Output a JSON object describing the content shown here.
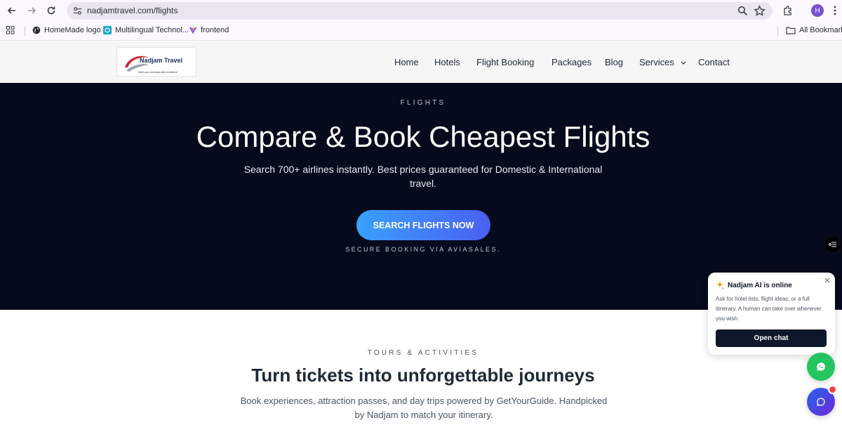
{
  "browser": {
    "url": "nadjamtravel.com/flights",
    "profile_initial": "H",
    "bookmarks": [
      "HomeMade logo",
      "Multilingual Technol...",
      "frontend"
    ],
    "all_bookmarks": "All Bookmarks"
  },
  "header": {
    "logo_text": "Nadjam Travel",
    "logo_tagline": "Meet your necessity with excellence",
    "nav": [
      "Home",
      "Hotels",
      "Flight Booking",
      "Packages",
      "Blog",
      "Services",
      "Contact"
    ]
  },
  "hero": {
    "eyebrow": "FLIGHTS",
    "title": "Compare & Book Cheapest Flights",
    "subtitle": "Search 700+ airlines instantly. Best prices guaranteed for Domestic & International travel.",
    "cta_label": "SEARCH FLIGHTS NOW",
    "secure_note": "SECURE BOOKING VIA AVIASALES."
  },
  "tours": {
    "eyebrow": "TOURS & ACTIVITIES",
    "title": "Turn tickets into unforgettable journeys",
    "subtitle": "Book experiences, attraction passes, and day trips powered by GetYourGuide. Handpicked by Nadjam to match your itinerary."
  },
  "chat": {
    "title": "Nadjam AI is online",
    "body": "Ask for hotel lists, flight ideas, or a full itinerary. A human can take over whenever you wish.",
    "button_label": "Open chat"
  },
  "colors": {
    "hero_bg": "#050a1c",
    "cta_start": "#39a1ff",
    "cta_end": "#4a5ff0",
    "whatsapp": "#22c55e",
    "chat_button": "#0f172a"
  }
}
